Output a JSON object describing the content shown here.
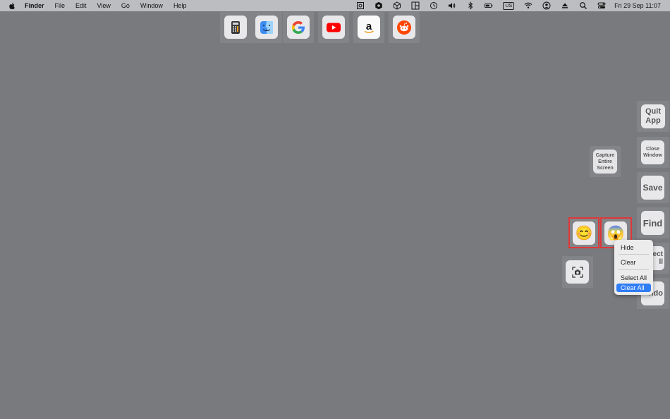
{
  "menubar": {
    "app_name": "Finder",
    "menus": [
      "File",
      "Edit",
      "View",
      "Go",
      "Window",
      "Help"
    ],
    "input_source": "US",
    "clock": "Fri 29 Sep  11:07"
  },
  "launcher": {
    "icons": [
      "calculator-icon",
      "finder-icon",
      "google-icon",
      "youtube-icon",
      "amazon-icon",
      "reddit-icon"
    ]
  },
  "actions": {
    "quit_app": "Quit App",
    "close_window": "Close Window",
    "save": "Save",
    "find": "Find",
    "select_all_partial": "ect",
    "select_all_partial2": "ll",
    "undo_partial": "ndo",
    "capture_entire_screen": "Capture Entire Screen"
  },
  "emoji": {
    "smile": "😊",
    "scream": "😱"
  },
  "context_menu": {
    "items": [
      "Hide",
      "Clear",
      "Select All",
      "Clear All"
    ],
    "highlighted": "Clear All"
  },
  "colors": {
    "desktop": "#797a7e",
    "highlight": "#2f7df6",
    "selection_outline": "#e0373a"
  }
}
